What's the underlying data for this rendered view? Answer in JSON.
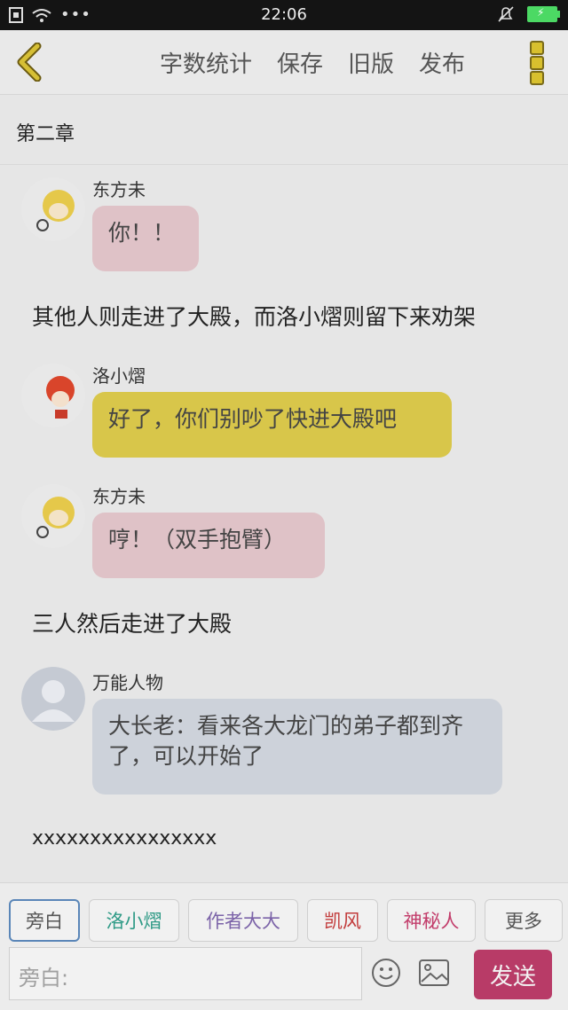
{
  "status_bar": {
    "time": "22:06"
  },
  "toolbar": {
    "word_count": "字数统计",
    "save": "保存",
    "old_version": "旧版",
    "publish": "发布"
  },
  "chapter": {
    "title": "第二章"
  },
  "messages": [
    {
      "name": "东方未",
      "text": "你！！"
    },
    {
      "narration": "其他人则走进了大殿，而洛小熠则留下来劝架"
    },
    {
      "name": "洛小熠",
      "text": "好了，你们别吵了快进大殿吧"
    },
    {
      "name": "东方未",
      "text": "哼！（双手抱臂）"
    },
    {
      "narration": "三人然后走进了大殿"
    },
    {
      "name": "万能人物",
      "text": "大长老：看来各大龙门的弟子都到齐了，可以开始了"
    },
    {
      "narration": "xxxxxxxxxxxxxxxx"
    }
  ],
  "composer": {
    "chips": [
      "旁白",
      "洛小熠",
      "作者大大",
      "凯风",
      "神秘人",
      "更多"
    ],
    "placeholder": "旁白:",
    "send": "发送"
  },
  "colors": {
    "pink_bubble": "#dfc2c7",
    "yellow_bubble": "#d8c64a",
    "gray_bubble": "#cdd2da",
    "send_button": "#b83b67"
  }
}
